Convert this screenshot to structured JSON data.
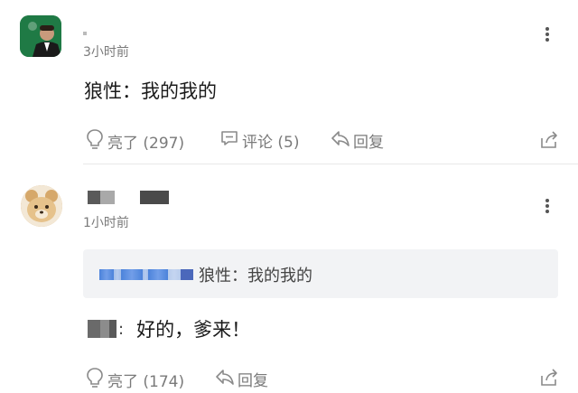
{
  "comments": [
    {
      "time": "3小时前",
      "text": "狼性：我的我的",
      "like_label": "亮了 (297)",
      "reply_count_label": "评论 (5)",
      "reply_label": "回复"
    },
    {
      "time": "1小时前",
      "quote_text": "狼性：我的我的",
      "text": "好的，爹来！",
      "like_label": "亮了 (174)",
      "reply_label": "回复"
    }
  ],
  "colors": {
    "blurred_link": "#2e6fd6",
    "muted": "#7a7a7a",
    "quote_bg": "#f2f3f5"
  }
}
